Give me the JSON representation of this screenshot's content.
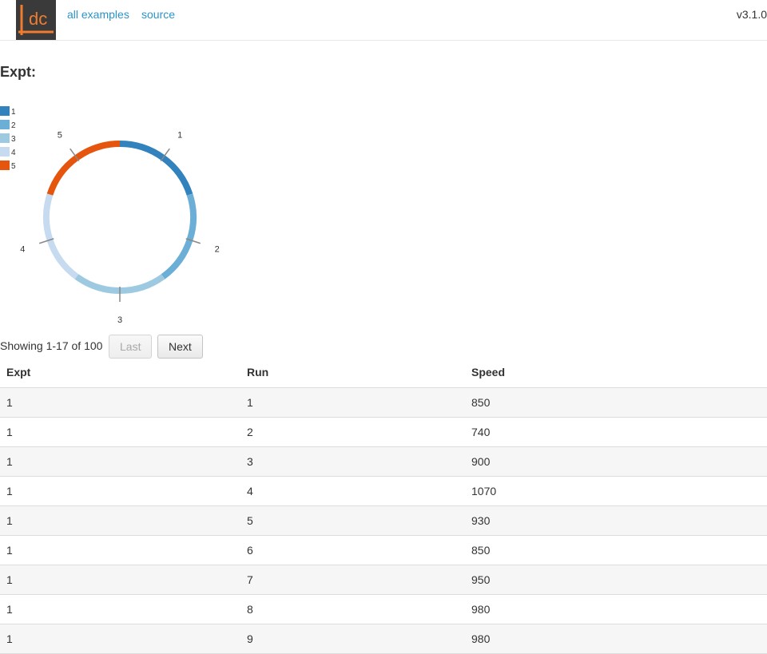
{
  "header": {
    "logo_text": "dc",
    "nav": [
      "all examples",
      "source"
    ],
    "version": "v3.1.0"
  },
  "page": {
    "title": "Expt:"
  },
  "colors": {
    "link": "#2a94c9",
    "series": [
      "#3182bd",
      "#6baed6",
      "#9ecae1",
      "#c6dbef",
      "#e6550d"
    ],
    "logo_bg": "#3a3a3a",
    "logo_accent": "#f07d2f"
  },
  "chart_data": {
    "type": "pie",
    "subtype": "donut",
    "categories": [
      "1",
      "2",
      "3",
      "4",
      "5"
    ],
    "values": [
      20,
      20,
      20,
      20,
      20
    ],
    "legend": [
      "1",
      "2",
      "3",
      "4",
      "5"
    ],
    "legend_position": "top-left"
  },
  "pagination": {
    "text": "Showing 1-17 of 100",
    "prev_label": "Last",
    "next_label": "Next",
    "prev_disabled": true
  },
  "table": {
    "columns": [
      "Expt",
      "Run",
      "Speed"
    ],
    "rows": [
      [
        "1",
        "1",
        "850"
      ],
      [
        "1",
        "2",
        "740"
      ],
      [
        "1",
        "3",
        "900"
      ],
      [
        "1",
        "4",
        "1070"
      ],
      [
        "1",
        "5",
        "930"
      ],
      [
        "1",
        "6",
        "850"
      ],
      [
        "1",
        "7",
        "950"
      ],
      [
        "1",
        "8",
        "980"
      ],
      [
        "1",
        "9",
        "980"
      ]
    ]
  }
}
